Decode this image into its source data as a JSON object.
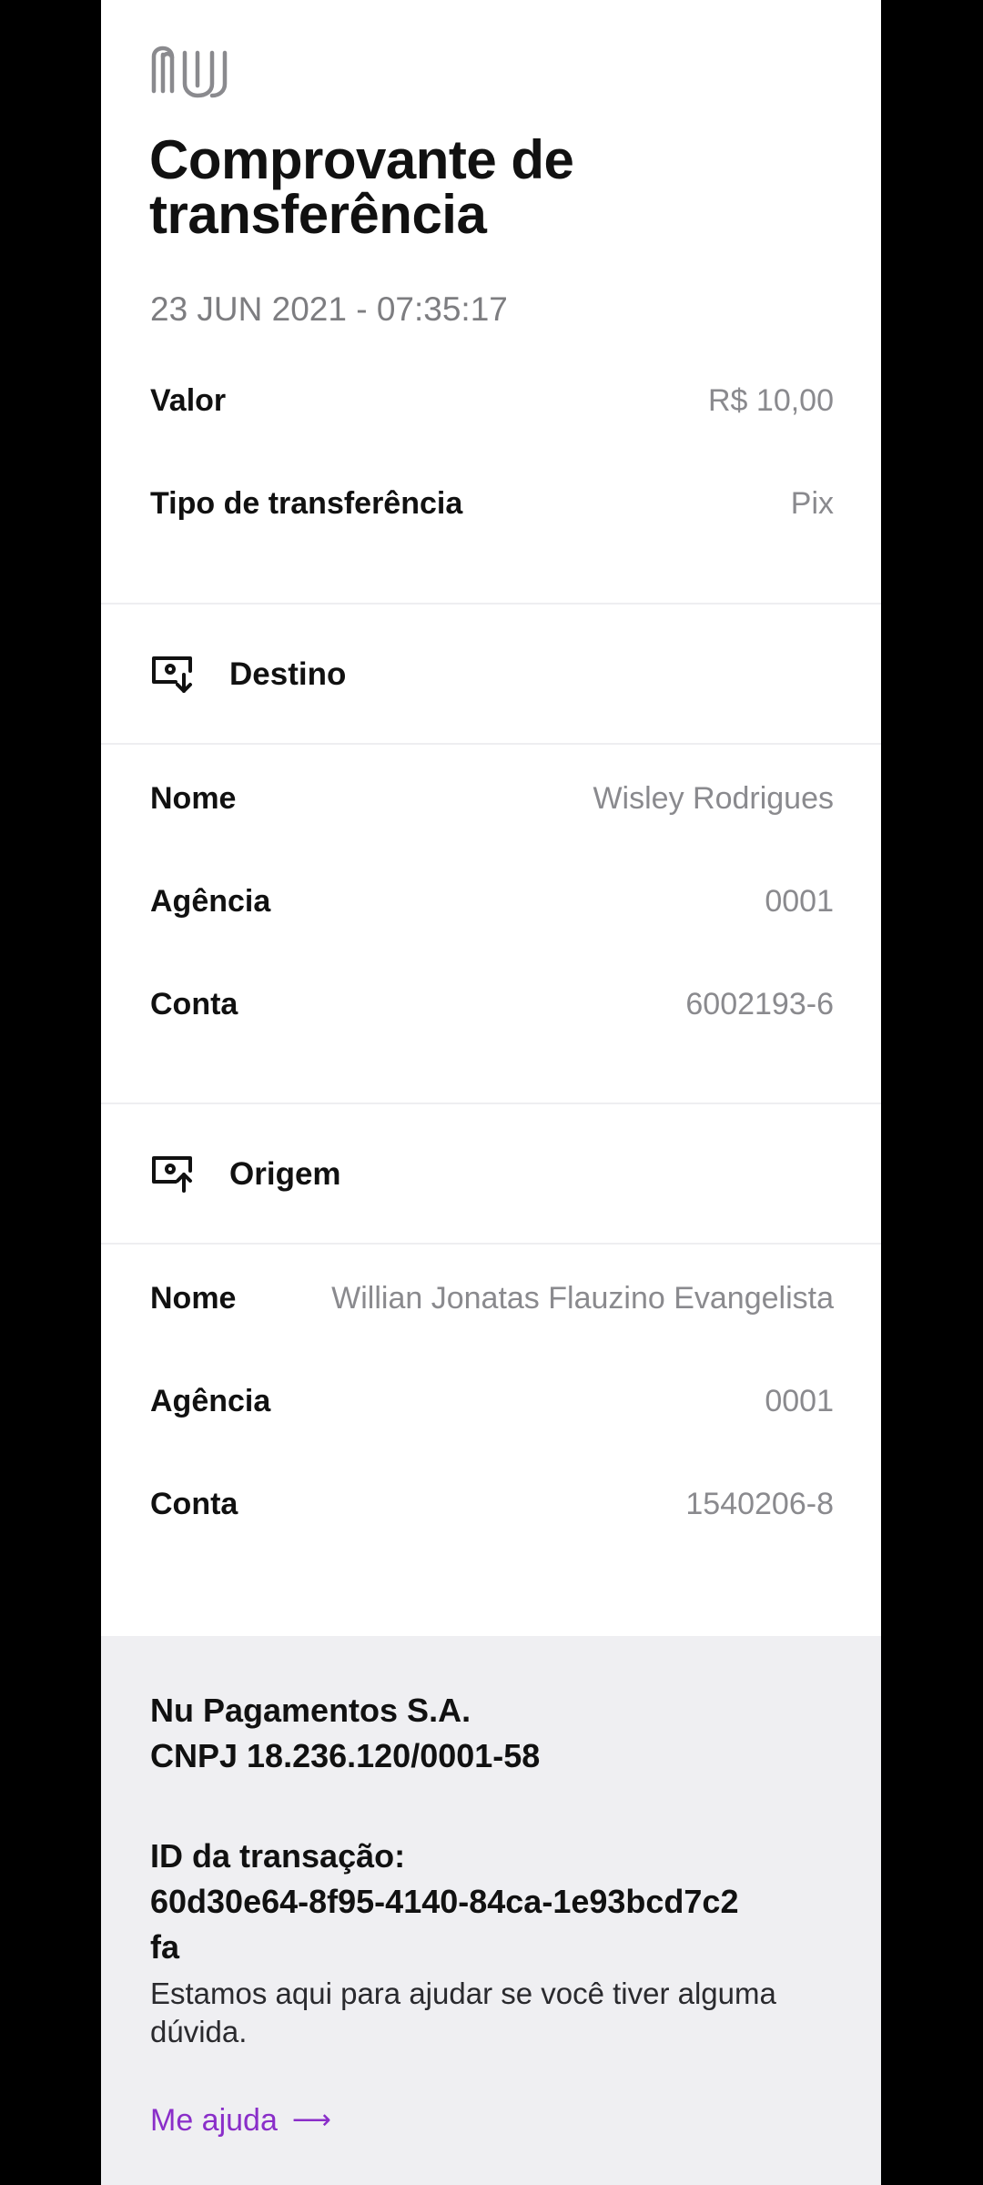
{
  "header": {
    "logo": "nu-logo",
    "title_line1": "Comprovante de",
    "title_line2": "transferência",
    "timestamp": "23 JUN 2021 - 07:35:17"
  },
  "summary": {
    "valor_label": "Valor",
    "valor_value": "R$ 10,00",
    "tipo_label": "Tipo de transferência",
    "tipo_value": "Pix"
  },
  "destino": {
    "icon": "account-in-icon",
    "title": "Destino",
    "nome_label": "Nome",
    "nome_value": "Wisley Rodrigues",
    "agencia_label": "Agência",
    "agencia_value": "0001",
    "conta_label": "Conta",
    "conta_value": "6002193-6"
  },
  "origem": {
    "icon": "account-out-icon",
    "title": "Origem",
    "nome_label": "Nome",
    "nome_value": "Willian Jonatas Flauzino Evangelista",
    "agencia_label": "Agência",
    "agencia_value": "0001",
    "conta_label": "Conta",
    "conta_value": "1540206-8"
  },
  "footer": {
    "company": "Nu Pagamentos S.A.",
    "cnpj": "CNPJ 18.236.120/0001-58",
    "id_label": "ID da transação:",
    "id_line1": "60d30e64-8f95-4140-84ca-1e93bcd7c2",
    "id_line2": "fa",
    "help_text": "Estamos aqui para ajudar se você tiver alguma dúvida.",
    "help_link": "Me ajuda",
    "help_arrow": "⟶"
  },
  "colors": {
    "background": "#000000",
    "card": "#ffffff",
    "footer": "#efeff2",
    "text": "#111111",
    "muted": "#8a8a8e",
    "link": "#8a2ec9"
  }
}
